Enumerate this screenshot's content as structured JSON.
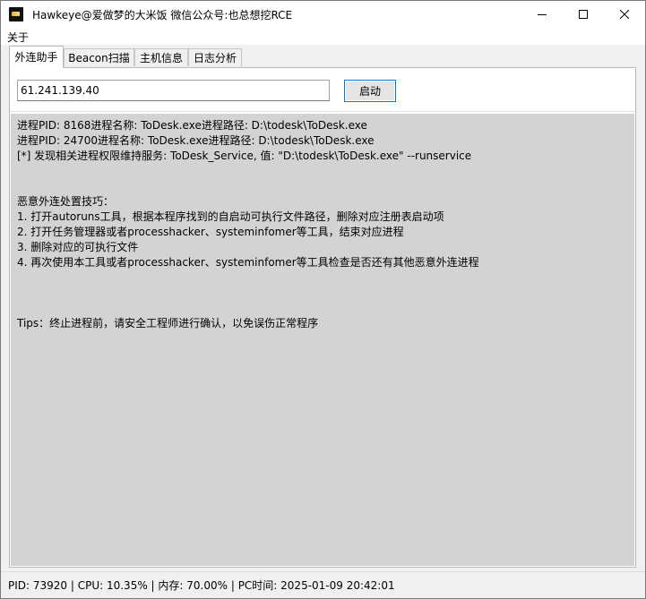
{
  "window": {
    "title": "Hawkeye@爱做梦的大米饭 微信公众号:也总想挖RCE"
  },
  "menu": {
    "items": [
      "关于"
    ]
  },
  "tabs": [
    {
      "label": "外连助手",
      "active": true
    },
    {
      "label": "Beacon扫描",
      "active": false
    },
    {
      "label": "主机信息",
      "active": false
    },
    {
      "label": "日志分析",
      "active": false
    }
  ],
  "connection": {
    "ip_value": "61.241.139.40",
    "start_label": "启动"
  },
  "output": {
    "lines": [
      "进程PID: 8168进程名称: ToDesk.exe进程路径: D:\\todesk\\ToDesk.exe",
      "进程PID: 24700进程名称: ToDesk.exe进程路径: D:\\todesk\\ToDesk.exe",
      "[*] 发现相关进程权限维持服务: ToDesk_Service, 值: \"D:\\todesk\\ToDesk.exe\" --runservice",
      "",
      "",
      "恶意外连处置技巧：",
      "1. 打开autoruns工具，根据本程序找到的自启动可执行文件路径，删除对应注册表启动项",
      "2. 打开任务管理器或者processhacker、systeminfomer等工具，结束对应进程",
      "3. 删除对应的可执行文件",
      "4. 再次使用本工具或者processhacker、systeminfomer等工具检查是否还有其他恶意外连进程",
      "",
      "",
      "",
      "Tips：终止进程前，请安全工程师进行确认，以免误伤正常程序"
    ]
  },
  "status": {
    "text": "PID: 73920 | CPU: 10.35% | 内存: 70.00% | PC时间: 2025-01-09 20:42:01"
  },
  "icons": {
    "app": "app-icon",
    "minimize": "minimize-icon",
    "maximize": "maximize-icon",
    "close": "close-icon"
  },
  "colors": {
    "output_background": "#d3d3d3",
    "focus_border": "#0078d4"
  }
}
